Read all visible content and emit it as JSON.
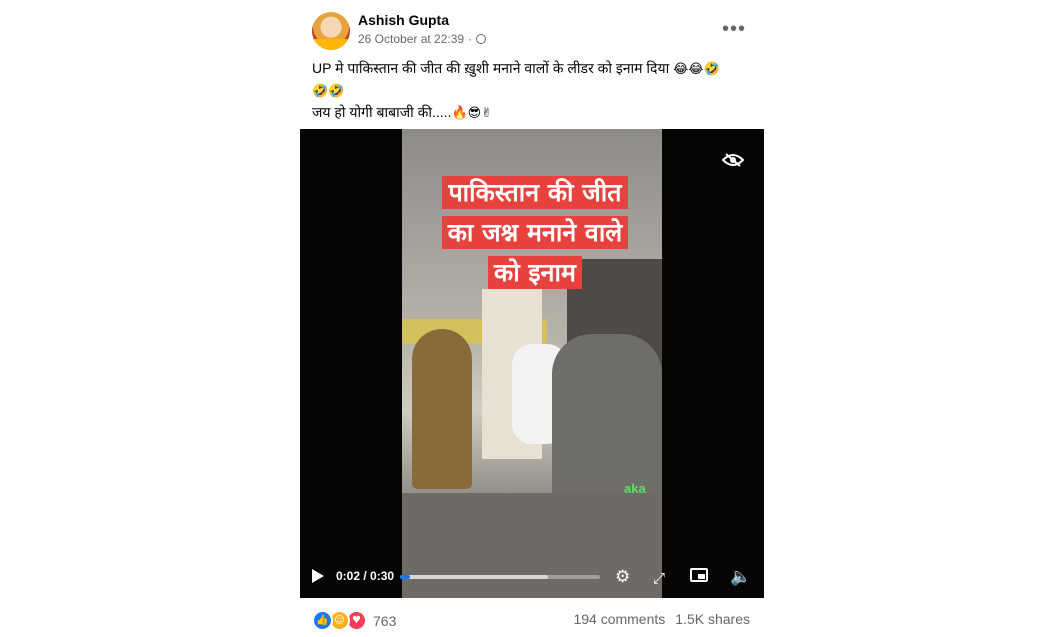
{
  "post": {
    "author": "Ashish Gupta",
    "date": "26 October at 22:39",
    "date_separator": "·",
    "more_label": "•••",
    "caption_line1": "UP मे पाकिस्तान की जीत की ख़ुशी मनाने वालों के लीडर को इनाम दिया",
    "caption_line1_emoji": "😂😂🤣",
    "caption_line2_emoji": "🤣🤣",
    "caption_line3": "जय हो योगी बाबाजी की.....",
    "caption_line3_emoji": "🔥😎✌"
  },
  "video": {
    "overlay_lines": [
      "पाकिस्तान की जीत",
      "का जश्न मनाने वाले",
      "को इनाम"
    ],
    "watermark": "aka",
    "time": "0:02 / 0:30",
    "progress_played": 0.05,
    "progress_buffered": 0.74,
    "icons": [
      "eye-slash-icon",
      "play-icon",
      "gear-icon",
      "expand-icon",
      "pip-icon",
      "volume-icon"
    ]
  },
  "footer": {
    "reaction_count": "763",
    "comments": "194 comments",
    "shares": "1.5K shares"
  },
  "colors": {
    "accent": "#1877f2",
    "overlay_bg": "#e8423f",
    "meta_text": "#65676b"
  }
}
